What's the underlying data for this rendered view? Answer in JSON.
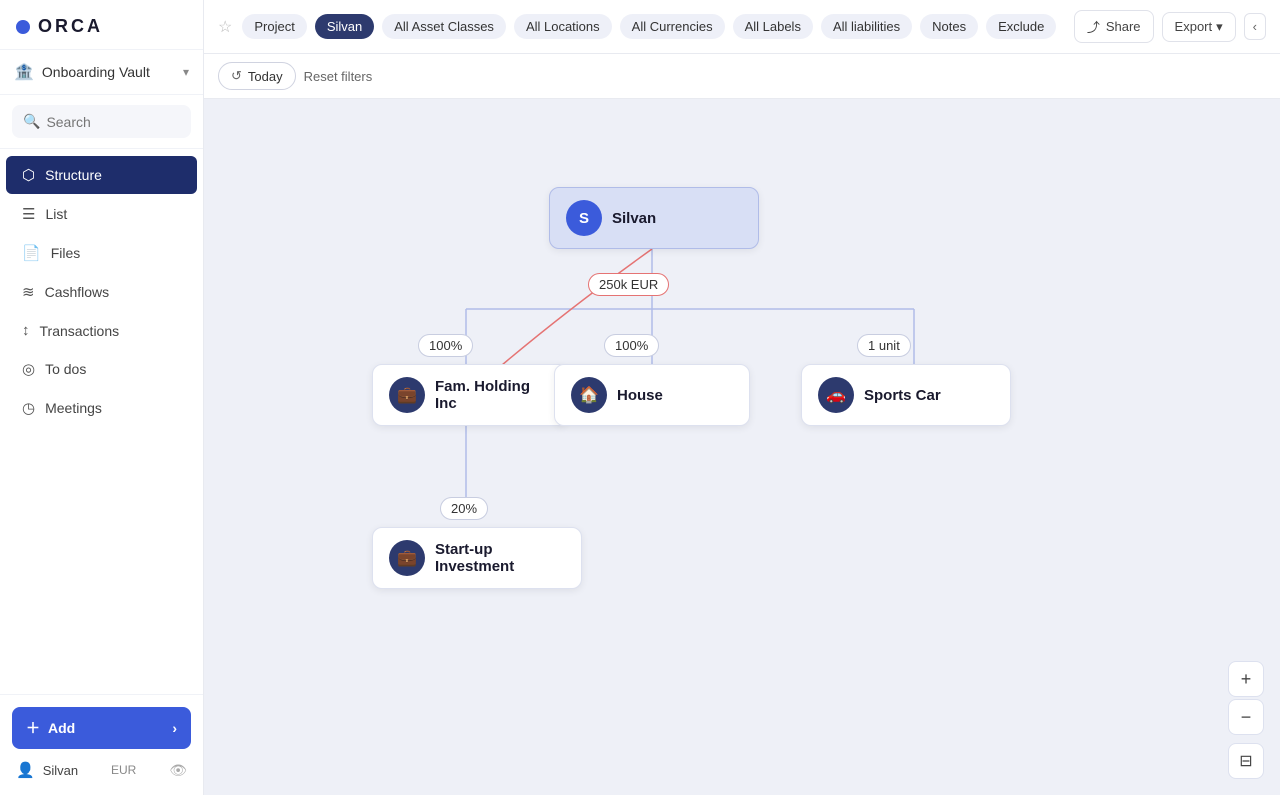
{
  "app": {
    "logo_text": "ORCA"
  },
  "sidebar": {
    "vault_label": "Onboarding Vault",
    "search_placeholder": "Search",
    "nav_items": [
      {
        "id": "structure",
        "label": "Structure",
        "icon": "⬡",
        "active": true
      },
      {
        "id": "list",
        "label": "List",
        "icon": "☰",
        "active": false
      },
      {
        "id": "files",
        "label": "Files",
        "icon": "📄",
        "active": false
      },
      {
        "id": "cashflows",
        "label": "Cashflows",
        "icon": "≋",
        "active": false
      },
      {
        "id": "transactions",
        "label": "Transactions",
        "icon": "↕",
        "active": false
      },
      {
        "id": "todos",
        "label": "To dos",
        "icon": "◎",
        "active": false
      },
      {
        "id": "meetings",
        "label": "Meetings",
        "icon": "◷",
        "active": false
      }
    ],
    "add_label": "Add",
    "user_name": "Silvan",
    "currency": "EUR"
  },
  "toolbar": {
    "project_label": "Project",
    "silvan_label": "Silvan",
    "asset_classes_label": "All Asset Classes",
    "locations_label": "All Locations",
    "currencies_label": "All Currencies",
    "labels_label": "All Labels",
    "liabilities_label": "All liabilities",
    "notes_label": "Notes",
    "exclude_label": "Exclude",
    "share_label": "Share",
    "export_label": "Export"
  },
  "filter_bar": {
    "today_label": "Today",
    "reset_label": "Reset filters"
  },
  "canvas": {
    "root_node": {
      "label": "Silvan",
      "initial": "S"
    },
    "nodes": [
      {
        "id": "fam",
        "label": "Fam. Holding Inc",
        "icon": "💼"
      },
      {
        "id": "house",
        "label": "House",
        "icon": "🏠"
      },
      {
        "id": "sportscar",
        "label": "Sports Car",
        "icon": "🚗"
      },
      {
        "id": "startup",
        "label": "Start-up Investment",
        "icon": "💼"
      }
    ],
    "edges": [
      {
        "id": "root-fam",
        "label": "100%"
      },
      {
        "id": "root-house",
        "label": "100%"
      },
      {
        "id": "root-sportscar",
        "label": "1 unit"
      },
      {
        "id": "root-center",
        "label": "250k EUR",
        "red": true
      },
      {
        "id": "fam-startup",
        "label": "20%"
      }
    ]
  },
  "zoom": {
    "plus_label": "+",
    "minus_label": "−",
    "filter_icon": "⊟"
  }
}
